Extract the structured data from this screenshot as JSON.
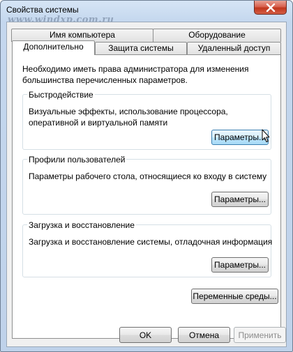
{
  "window": {
    "title": "Свойства системы",
    "watermark": "www.windxp.com.ru"
  },
  "tabs": {
    "row1": [
      {
        "label": "Имя компьютера"
      },
      {
        "label": "Оборудование"
      }
    ],
    "row2": [
      {
        "label": "Дополнительно",
        "active": true
      },
      {
        "label": "Защита системы"
      },
      {
        "label": "Удаленный доступ"
      }
    ]
  },
  "panel": {
    "info": "Необходимо иметь права администратора для изменения большинства перечисленных параметров.",
    "performance": {
      "legend": "Быстродействие",
      "description": "Визуальные эффекты, использование процессора, оперативной и виртуальной памяти",
      "button": "Параметры..."
    },
    "profiles": {
      "legend": "Профили пользователей",
      "description": "Параметры рабочего стола, относящиеся ко входу в систему",
      "button": "Параметры..."
    },
    "startup": {
      "legend": "Загрузка и восстановление",
      "description": "Загрузка и восстановление системы, отладочная информация",
      "button": "Параметры..."
    },
    "env_button": "Переменные среды..."
  },
  "footer": {
    "ok": "OK",
    "cancel": "Отмена",
    "apply": "Применить"
  },
  "colors": {
    "title_bar": "#c4d7ee",
    "close_button": "#c0361d",
    "hover_button": "#bee6fd"
  }
}
